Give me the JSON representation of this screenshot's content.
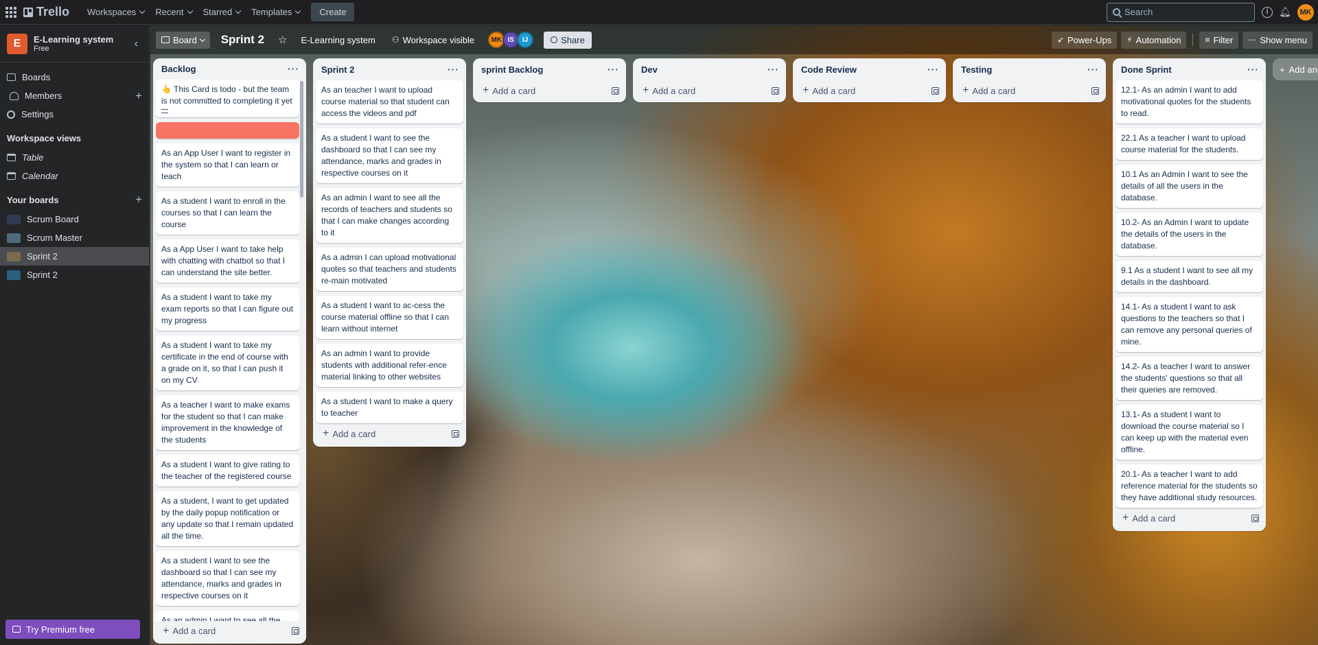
{
  "topnav": {
    "brand": "Trello",
    "menus": [
      "Workspaces",
      "Recent",
      "Starred",
      "Templates"
    ],
    "create_label": "Create",
    "search_placeholder": "Search",
    "user_initials": "MK"
  },
  "sidebar": {
    "workspace_name": "E-Learning system",
    "workspace_initial": "E",
    "workspace_plan": "Free",
    "items": [
      {
        "label": "Boards"
      },
      {
        "label": "Members"
      },
      {
        "label": "Settings"
      }
    ],
    "views_heading": "Workspace views",
    "views": [
      {
        "label": "Table"
      },
      {
        "label": "Calendar"
      }
    ],
    "boards_heading": "Your boards",
    "boards": [
      {
        "label": "Scrum Board",
        "color": "#2f3b55"
      },
      {
        "label": "Scrum Master",
        "color": "#4d6b78"
      },
      {
        "label": "Sprint 2",
        "color": "#7a6a50",
        "active": true
      },
      {
        "label": "Sprint 2",
        "color": "#2c5f80"
      }
    ],
    "premium_label": "Try Premium free"
  },
  "board": {
    "view_label": "Board",
    "title": "Sprint 2",
    "workspace_label": "E-Learning system",
    "visibility_label": "Workspace visible",
    "members": [
      {
        "initials": "MK",
        "color": "#f18d13"
      },
      {
        "initials": "IS",
        "color": "#5e4db2"
      },
      {
        "initials": "IJ",
        "color": "#1f9ad1"
      }
    ],
    "share_label": "Share",
    "powerups_label": "Power-Ups",
    "automation_label": "Automation",
    "filter_label": "Filter",
    "menu_label": "Show menu",
    "add_list_label": "Add another list"
  },
  "lists": {
    "backlog": {
      "title": "Backlog",
      "cards": [
        "👆 This Card is todo - but the team is not committed to completing it yet",
        "As an App User I want to register in the system so that I can learn or teach",
        "As a student I want to enroll in the courses so that I can learn the course",
        "As a App User I want to take help with chatting with chatbot so that I can understand the site better.",
        "As a student I want to take my exam reports so that I can figure out my progress",
        "As a student I want to take my certificate in the end of course with a grade on it, so that I can push it on my CV",
        "As a teacher I want to make exams for the student so that I can make improvement in the knowledge of the students",
        "As a student I want to give rating to the teacher of the registered course",
        "As a student, I want to get updated by the daily popup notification or any update so that I remain updated all the time.",
        "As a student I want to see the dashboard so that I can see my attendance, marks and grades in respective courses on it",
        "As an admin I want to see all the records of teachers and students so"
      ]
    },
    "sprint2": {
      "title": "Sprint 2",
      "cards": [
        "As an teacher I want to upload course material so that student can access the videos and pdf",
        "As a student I want to see the dashboard so that I can see my attendance, marks and grades in respective courses on it",
        "As an admin I want to see all the records of teachers and students so that I can make changes according to it",
        "As a admin I can upload motivational quotes so that teachers and students re-main motivated",
        "As a student I want to ac-cess the course material offline so that I can learn without internet",
        "As an admin I want to provide students with additional refer-ence material linking to other websites",
        "As a student I want to make a query to teacher"
      ]
    },
    "sprint_backlog": {
      "title": "sprint Backlog"
    },
    "dev": {
      "title": "Dev"
    },
    "code_review": {
      "title": "Code Review"
    },
    "testing": {
      "title": "Testing"
    },
    "done": {
      "title": "Done Sprint",
      "cards": [
        "12.1- As an admin I want to add motivational quotes for the students to read.",
        "22.1 As a teacher I want to upload course material for the students.",
        "10.1 As an Admin I want to see the details of all the users in the database.",
        "10.2- As an Admin I want to update the details of the users in the database.",
        "9.1 As a student I want to see all my details in the dashboard.",
        "14.1- As a student I want to ask questions to the teachers so that I can remove any personal queries of mine.",
        "14.2- As a teacher I want to answer the students' questions so that all their queries are removed.",
        "13.1- As a student I want to download the course material so I can keep up with the material even offline.",
        "20.1- As a teacher I want to add reference material for the students so they have additional study resources."
      ]
    },
    "add_card_label": "Add a card"
  }
}
